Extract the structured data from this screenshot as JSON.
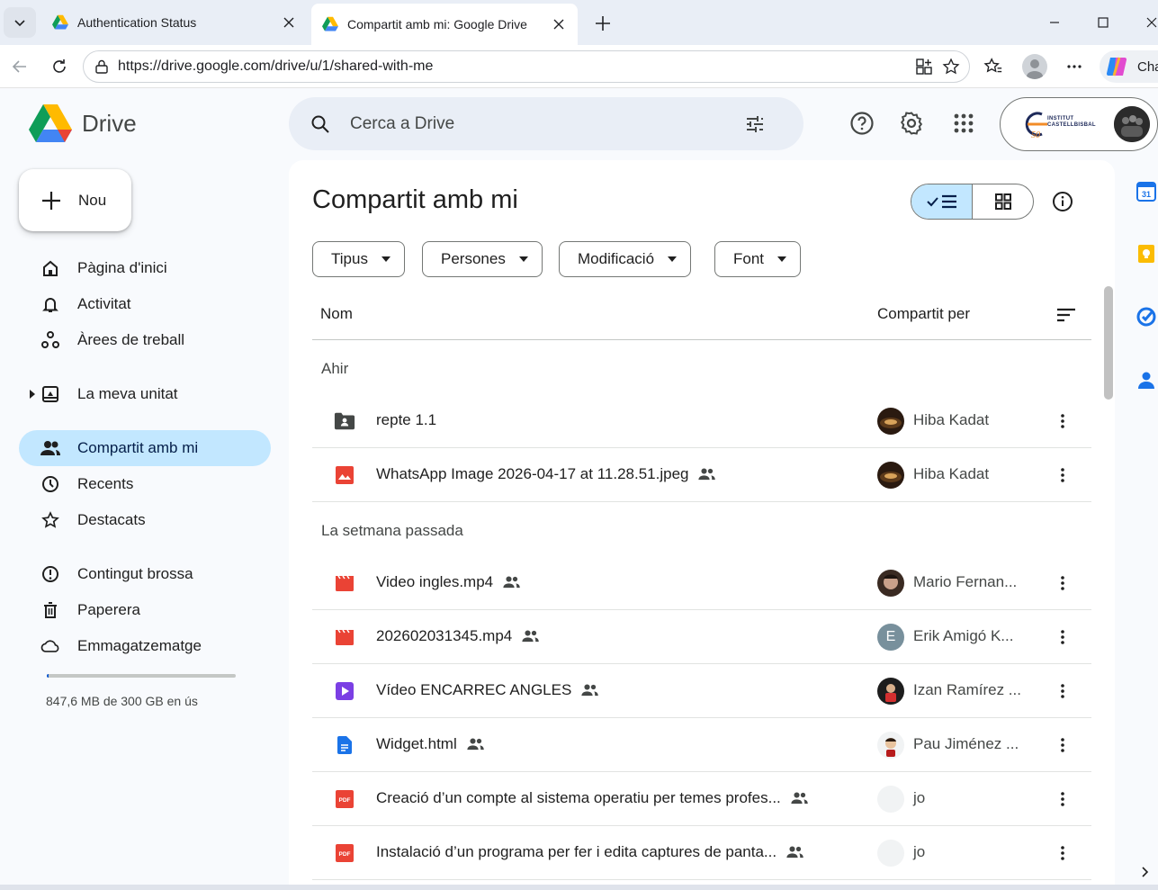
{
  "browser": {
    "tabs": [
      {
        "title": "Authentication Status",
        "active": false
      },
      {
        "title": "Compartit amb mi: Google Drive",
        "active": true
      }
    ],
    "url": "https://drive.google.com/drive/u/1/shared-with-me",
    "copilot_label": "Cha"
  },
  "drive": {
    "product_name": "Drive",
    "search_placeholder": "Cerca a Drive",
    "org_logo_text": "INSTITUT CASTELLBISBAL",
    "new_button": "Nou"
  },
  "sidebar": {
    "items": [
      {
        "label": "Pàgina d'inici",
        "icon": "home-icon"
      },
      {
        "label": "Activitat",
        "icon": "bell-icon"
      },
      {
        "label": "Àrees de treball",
        "icon": "workspaces-icon"
      },
      {
        "label": "La meva unitat",
        "icon": "my-drive-icon"
      },
      {
        "label": "Compartit amb mi",
        "icon": "shared-people-icon",
        "active": true
      },
      {
        "label": "Recents",
        "icon": "clock-icon"
      },
      {
        "label": "Destacats",
        "icon": "star-icon"
      },
      {
        "label": "Contingut brossa",
        "icon": "spam-icon"
      },
      {
        "label": "Paperera",
        "icon": "trash-icon"
      },
      {
        "label": "Emmagatzematge",
        "icon": "cloud-icon"
      }
    ],
    "storage_text": "847,6 MB de 300 GB en ús",
    "storage_used_fraction": 0.003
  },
  "main": {
    "title": "Compartit amb mi",
    "filters": [
      "Tipus",
      "Persones",
      "Modificació",
      "Font"
    ],
    "columns": {
      "name": "Nom",
      "shared_by": "Compartit per"
    },
    "groups": [
      {
        "label": "Ahir",
        "files": [
          {
            "name": "repte 1.1",
            "type": "shared-folder",
            "shared": false,
            "owner": "Hiba Kadat"
          },
          {
            "name": "WhatsApp Image 2026-04-17 at 11.28.51.jpeg",
            "type": "image",
            "shared": true,
            "owner": "Hiba Kadat"
          }
        ]
      },
      {
        "label": "La setmana passada",
        "files": [
          {
            "name": "Video ingles.mp4",
            "type": "video",
            "shared": true,
            "owner": "Mario Fernan..."
          },
          {
            "name": "202602031345.mp4",
            "type": "video",
            "shared": true,
            "owner": "Erik Amigó K...",
            "owner_initial": "E"
          },
          {
            "name": "Vídeo ENCARREC ANGLES",
            "type": "vids",
            "shared": true,
            "owner": "Izan Ramírez ..."
          },
          {
            "name": "Widget.html",
            "type": "doc",
            "shared": true,
            "owner": "Pau Jiménez ..."
          },
          {
            "name": "Creació d’un compte al sistema operatiu per temes profes...",
            "type": "pdf",
            "shared": true,
            "owner": "jo"
          },
          {
            "name": "Instalació d’un programa per fer i edita captures de panta...",
            "type": "pdf",
            "shared": true,
            "owner": "jo"
          }
        ]
      }
    ]
  },
  "colors": {
    "accent": "#0b57d0",
    "active_nav": "#c2e7ff",
    "search_bg": "#e9eef6",
    "red_file": "#ea4335",
    "purple_vids": "#7b3fe4",
    "blue_doc": "#1a73e8"
  }
}
